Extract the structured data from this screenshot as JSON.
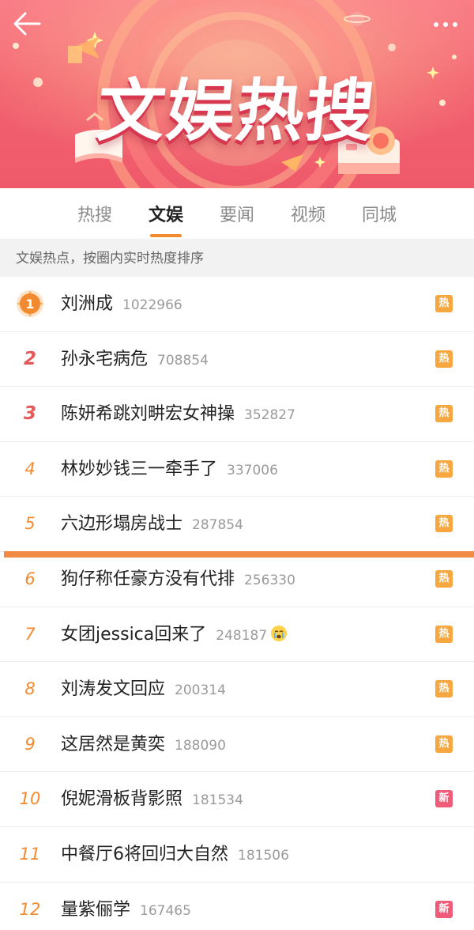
{
  "banner": {
    "title": "文娱热搜",
    "back_icon": "arrow-left-icon",
    "more_icon": "more-dots-icon",
    "gradient_colors": [
      "#f97a86",
      "#ef5a6b"
    ]
  },
  "tabs": [
    {
      "label": "热搜",
      "active": false
    },
    {
      "label": "文娱",
      "active": true
    },
    {
      "label": "要闻",
      "active": false
    },
    {
      "label": "视频",
      "active": false
    },
    {
      "label": "同城",
      "active": false
    }
  ],
  "subtitle": "文娱热点，按圈内实时热度排序",
  "items": [
    {
      "rank": "1",
      "title": "刘洲成",
      "count": "1022966",
      "badge": "热",
      "badge_type": "hot"
    },
    {
      "rank": "2",
      "title": "孙永宅病危",
      "count": "708854",
      "badge": "热",
      "badge_type": "hot"
    },
    {
      "rank": "3",
      "title": "陈妍希跳刘畊宏女神操",
      "count": "352827",
      "badge": "热",
      "badge_type": "hot"
    },
    {
      "rank": "4",
      "title": "林妙妙钱三一牵手了",
      "count": "337006",
      "badge": "热",
      "badge_type": "hot"
    },
    {
      "rank": "5",
      "title": "六边形塌房战士",
      "count": "287854",
      "badge": "热",
      "badge_type": "hot"
    },
    {
      "rank": "6",
      "title": "狗仔称任豪方没有代排",
      "count": "256330",
      "badge": "热",
      "badge_type": "hot"
    },
    {
      "rank": "7",
      "title": "女团jessica回来了",
      "count": "248187",
      "badge": "热",
      "badge_type": "hot",
      "emoji": "crying-face-icon"
    },
    {
      "rank": "8",
      "title": "刘涛发文回应",
      "count": "200314",
      "badge": "热",
      "badge_type": "hot"
    },
    {
      "rank": "9",
      "title": "这居然是黄奕",
      "count": "188090",
      "badge": "热",
      "badge_type": "hot"
    },
    {
      "rank": "10",
      "title": "倪妮滑板背影照",
      "count": "181534",
      "badge": "新",
      "badge_type": "new"
    },
    {
      "rank": "11",
      "title": "中餐厅6将回归大自然",
      "count": "181506",
      "badge": "",
      "badge_type": ""
    },
    {
      "rank": "12",
      "title": "量紫俪学",
      "count": "167465",
      "badge": "新",
      "badge_type": "new"
    }
  ],
  "colors": {
    "accent": "#f28a30",
    "hot_badge": "#f7a740",
    "new_badge": "#ef5b79",
    "divider": "#f08a45"
  }
}
